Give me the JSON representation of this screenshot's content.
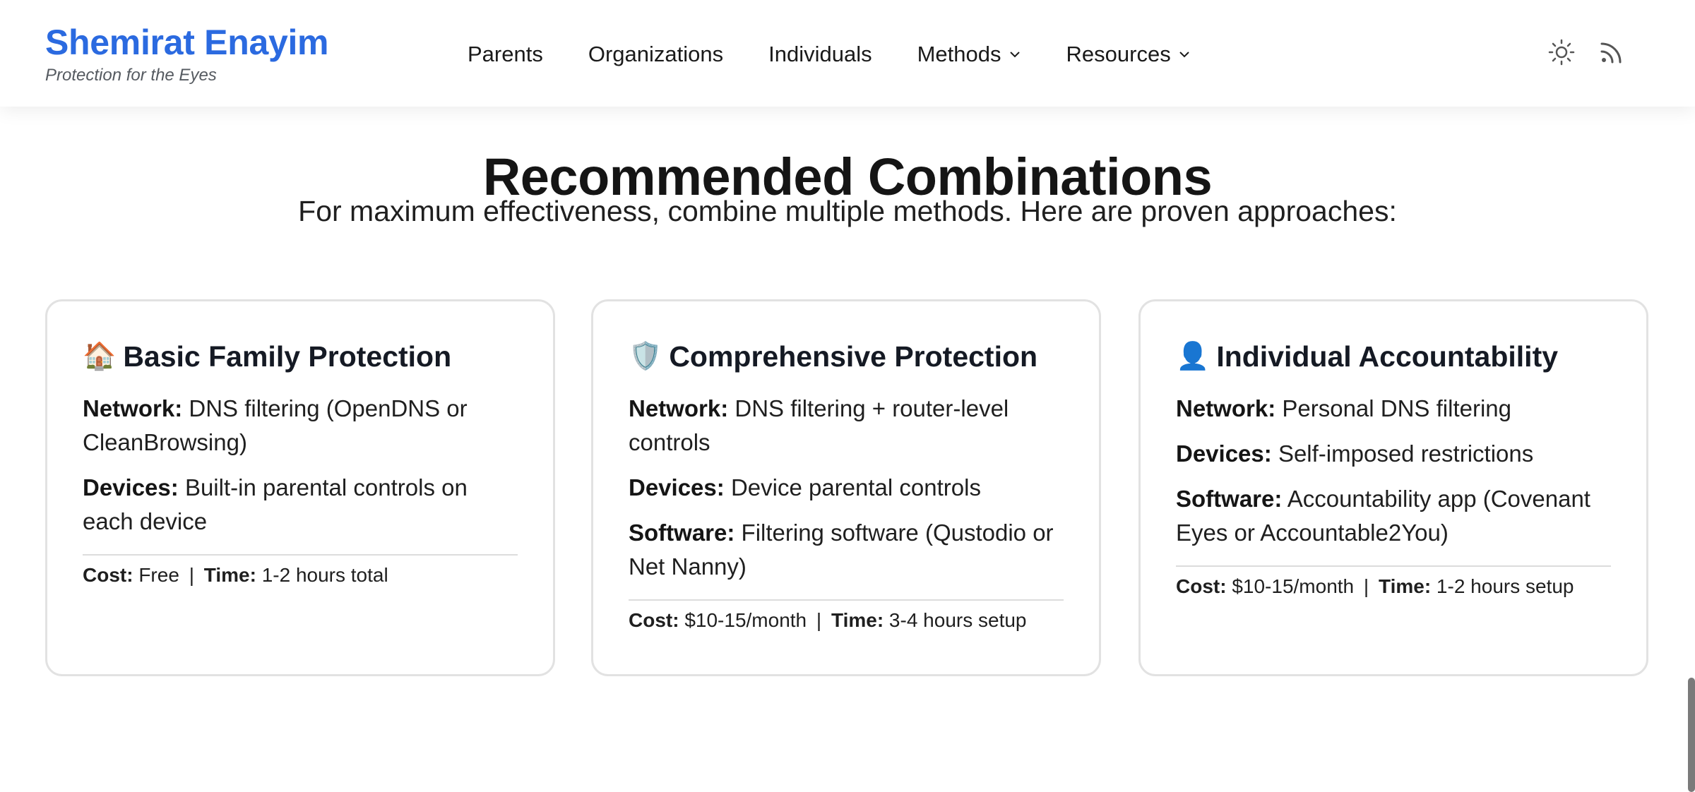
{
  "brand": {
    "title": "Shemirat Enayim",
    "tagline": "Protection for the Eyes",
    "color": "#2b6ae0"
  },
  "nav": {
    "items": [
      {
        "label": "Parents"
      },
      {
        "label": "Organizations"
      },
      {
        "label": "Individuals"
      },
      {
        "label": "Methods"
      },
      {
        "label": "Resources"
      }
    ]
  },
  "header_icons": {
    "theme": "sun-icon",
    "feed": "rss-icon"
  },
  "main": {
    "title": "Recommended Combinations",
    "subtitle": "For maximum effectiveness, combine multiple methods. Here are proven approaches:",
    "cards": [
      {
        "emoji": "🏠",
        "icon": "house-icon",
        "title": "Basic Family Protection",
        "rows": [
          {
            "key": "Network:",
            "value": "DNS filtering (OpenDNS or CleanBrowsing)"
          },
          {
            "key": "Devices:",
            "value": "Built-in parental controls on each device"
          }
        ],
        "cost_label": "Cost:",
        "cost": "Free",
        "sep": "|",
        "time_label": "Time:",
        "time": "1-2 hours total"
      },
      {
        "emoji": "🛡️",
        "icon": "shield-icon",
        "title": "Comprehensive Protection",
        "rows": [
          {
            "key": "Network:",
            "value": "DNS filtering + router-level controls"
          },
          {
            "key": "Devices:",
            "value": "Device parental controls"
          },
          {
            "key": "Software:",
            "value": "Filtering software (Qustodio or Net Nanny)"
          }
        ],
        "cost_label": "Cost:",
        "cost": "$10-15/month",
        "sep": "|",
        "time_label": "Time:",
        "time": "3-4 hours setup"
      },
      {
        "emoji": "👤",
        "icon": "person-icon",
        "title": "Individual Accountability",
        "rows": [
          {
            "key": "Network:",
            "value": "Personal DNS filtering"
          },
          {
            "key": "Devices:",
            "value": "Self-imposed restrictions"
          },
          {
            "key": "Software:",
            "value": "Accountability app (Covenant Eyes or Accountable2You)"
          }
        ],
        "cost_label": "Cost:",
        "cost": "$10-15/month",
        "sep": "|",
        "time_label": "Time:",
        "time": "1-2 hours setup"
      }
    ]
  }
}
